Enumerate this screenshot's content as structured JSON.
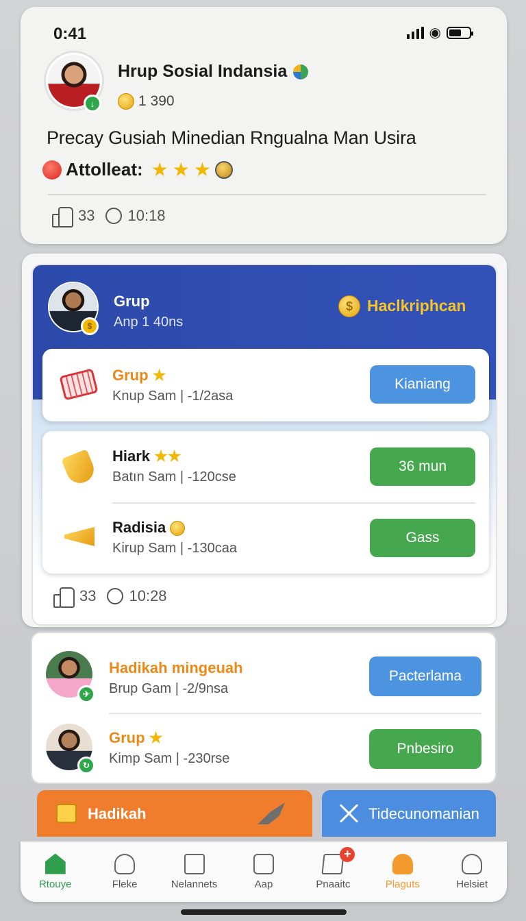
{
  "status": {
    "time": "0:41"
  },
  "profile": {
    "name": "Hrup Sosial Indansia",
    "coins": "1 390",
    "headline": "Precay Gusiah Minedian Rngualna Man Usira",
    "rating_label": "Attolleat:",
    "stars": 3,
    "likes": "33",
    "time": "10:18"
  },
  "feed": {
    "header": {
      "title": "Grup",
      "subtitle": "Anp 1 40ns",
      "coin_symbol": "$",
      "link": "Haclkriphcan"
    },
    "rows": [
      {
        "title": "Grup",
        "title_color": "orange",
        "subtitle": "Knup Sam | -1/2asa",
        "button": "Kianiang",
        "button_color": "blue"
      },
      {
        "title": "Hiark",
        "subtitle": "Batın Sam | -120cse",
        "button": "36 mun",
        "button_color": "green"
      },
      {
        "title": "Radisia",
        "subtitle": "Kirup Sam | -130caa",
        "button": "Gass",
        "button_color": "green"
      }
    ],
    "likes": "33",
    "time": "10:28"
  },
  "list": [
    {
      "title": "Hadikah mingeuah",
      "subtitle": "Brup Gam | -2/9nsa",
      "button": "Pacterlama",
      "button_color": "blue"
    },
    {
      "title": "Grup",
      "subtitle": "Kimp Sam | -230rse",
      "button": "Pnbesiro",
      "button_color": "green"
    }
  ],
  "actions": {
    "primary": "Hadikah",
    "secondary": "Tidecunomanian"
  },
  "nav": [
    {
      "label": "Rtouye",
      "icon": "home-icon",
      "active": true
    },
    {
      "label": "Fleke",
      "icon": "search-person-icon"
    },
    {
      "label": "Nelannets",
      "icon": "document-icon"
    },
    {
      "label": "Aap",
      "icon": "chat-icon"
    },
    {
      "label": "Pnaaitc",
      "icon": "news-icon"
    },
    {
      "label": "Plaguts",
      "icon": "profile-icon",
      "highlight": true
    },
    {
      "label": "Helsiet",
      "icon": "user-icon"
    }
  ],
  "colors": {
    "header_blue": "#2c4aaa",
    "button_blue": "#4c93e0",
    "button_green": "#46a84e",
    "accent_orange": "#e88a1a",
    "action_orange": "#ef7d2c",
    "nav_active_green": "#2e9e4a"
  }
}
